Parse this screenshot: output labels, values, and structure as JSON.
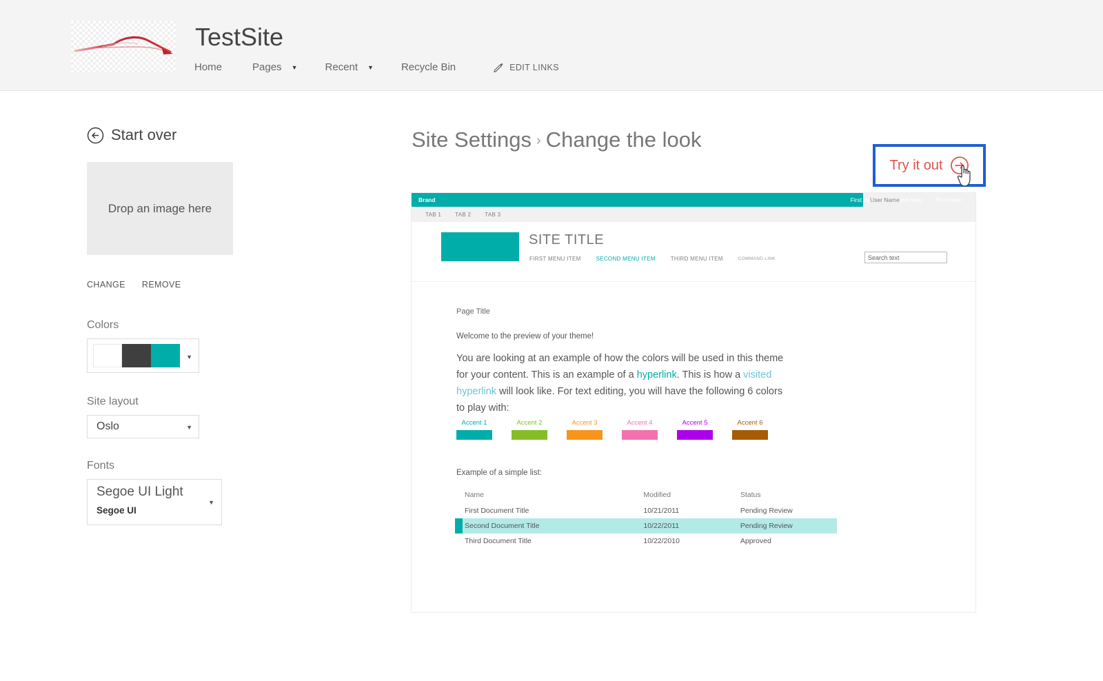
{
  "suite": {
    "site_title": "TestSite",
    "logo_icon": "car-silhouette-logo",
    "nav": [
      {
        "label": "Home",
        "has_caret": false
      },
      {
        "label": "Pages",
        "has_caret": true
      },
      {
        "label": "Recent",
        "has_caret": true
      },
      {
        "label": "Recycle Bin",
        "has_caret": false
      }
    ],
    "edit_links": {
      "label": "EDIT LINKS",
      "icon": "pencil-icon"
    }
  },
  "sidebar": {
    "start_over": {
      "label": "Start over",
      "icon": "back-circle-arrow-icon"
    },
    "image": {
      "dropzone_label": "Drop an image here",
      "change_label": "CHANGE",
      "remove_label": "REMOVE"
    },
    "colors": {
      "label": "Colors",
      "swatches": [
        "#ffffff",
        "#3f3f3f",
        "#00ada9"
      ],
      "caret_icon": "chevron-down-icon"
    },
    "site_layout": {
      "label": "Site layout",
      "value": "Oslo",
      "caret_icon": "chevron-down-icon"
    },
    "fonts": {
      "label": "Fonts",
      "heading_font": "Segoe UI Light",
      "body_font": "Segoe UI",
      "caret_icon": "chevron-down-icon"
    }
  },
  "main": {
    "breadcrumb_parent": "Site Settings",
    "breadcrumb_separator": "›",
    "breadcrumb_current": "Change the look",
    "try_it_out": {
      "label": "Try it out",
      "icon": "circle-arrow-right-icon",
      "label_color": "#e0534d",
      "highlight_box_color": "#1f5fd0",
      "cursor_icon": "hand-pointer-cursor"
    }
  },
  "preview": {
    "theme_accent": "#00ada9",
    "suite_bar": {
      "brand": "Brand",
      "links": [
        "First Item",
        "Second Item",
        "Third Item"
      ],
      "user_name": "User Name"
    },
    "tabs": [
      "TAB 1",
      "TAB 2",
      "TAB 3"
    ],
    "header": {
      "site_title": "SITE TITLE",
      "menu": [
        {
          "label": "FIRST MENU ITEM",
          "state": "normal"
        },
        {
          "label": "SECOND MENU ITEM",
          "state": "active"
        },
        {
          "label": "THIRD MENU ITEM",
          "state": "normal"
        },
        {
          "label": "COMMAND LINK",
          "state": "command"
        }
      ],
      "search_value": "Search text"
    },
    "content": {
      "page_title": "Page Title",
      "welcome": "Welcome to the preview of your theme!",
      "paragraph_part1": "You are looking at an example of how the colors will be used in this theme for your content. This is an example of a ",
      "link_unvisited": "hyperlink",
      "paragraph_part2": ". This is how a ",
      "link_visited": "visited hyperlink",
      "paragraph_part3": " will look like. For text editing, you will have the following 6 colors to play with:",
      "accents": [
        {
          "label": "Accent 1",
          "color": "#00ada9"
        },
        {
          "label": "Accent 2",
          "color": "#84bd27"
        },
        {
          "label": "Accent 3",
          "color": "#f7941e"
        },
        {
          "label": "Accent 4",
          "color": "#f470ae"
        },
        {
          "label": "Accent 5",
          "color": "#ab00ea"
        },
        {
          "label": "Accent 6",
          "color": "#a45c07"
        }
      ],
      "list_caption": "Example of a simple list:",
      "table": {
        "columns": [
          "Name",
          "Modified",
          "Status"
        ],
        "rows": [
          {
            "name": "First Document Title",
            "modified": "10/21/2011",
            "status": "Pending Review",
            "selected": false
          },
          {
            "name": "Second Document Title",
            "modified": "10/22/2011",
            "status": "Pending Review",
            "selected": true
          },
          {
            "name": "Third Document Title",
            "modified": "10/22/2010",
            "status": "Approved",
            "selected": false
          }
        ]
      }
    }
  }
}
